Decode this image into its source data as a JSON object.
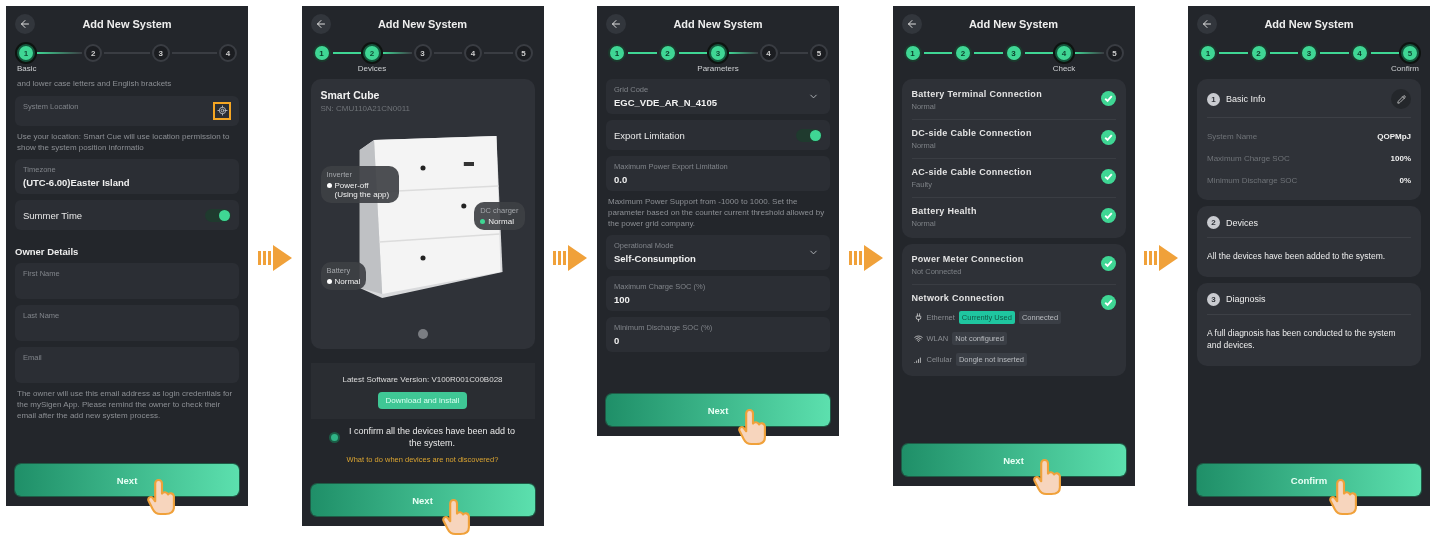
{
  "screens": [
    {
      "title": "Add New System",
      "steps": [
        {
          "label": "1",
          "done": false,
          "selected": true
        },
        {
          "label": "2",
          "done": false,
          "selected": false
        },
        {
          "label": "3",
          "done": false,
          "selected": false
        },
        {
          "label": "4",
          "done": false,
          "selected": false
        }
      ],
      "caption": "Basic",
      "sections": [
        {
          "kind": "note",
          "text": "and lower case letters and English brackets"
        },
        {
          "kind": "field",
          "label": "System Location",
          "locate": true,
          "highlighted": true
        },
        {
          "kind": "note",
          "text": "Use your location: Smart Cue will use location permission to show the system position informatio"
        },
        {
          "kind": "field",
          "label": "Timezone",
          "value": "(UTC-6.00)Easter Island"
        },
        {
          "kind": "toggle",
          "label": "Summer Time",
          "on": true
        },
        {
          "kind": "heading",
          "text": "Owner Details"
        },
        {
          "kind": "field",
          "label": "First Name"
        },
        {
          "kind": "field",
          "label": "Last Name"
        },
        {
          "kind": "field",
          "label": "Email"
        },
        {
          "kind": "note",
          "text": "The owner will use this email address as login credentials for the mySigen App. Please remind the owner to check their email after the add new system process."
        }
      ],
      "button": "Next"
    },
    {
      "title": "Add New System",
      "steps": [
        {
          "label": "1",
          "done": true,
          "selected": false
        },
        {
          "label": "2",
          "done": false,
          "selected": true
        },
        {
          "label": "3",
          "done": false,
          "selected": false
        },
        {
          "label": "4",
          "done": false,
          "selected": false
        },
        {
          "label": "5",
          "done": false,
          "selected": false
        }
      ],
      "caption": "Devices",
      "sections": [
        {
          "kind": "device",
          "name": "Smart Cube",
          "sn": "SN: CMU110A21CN0011",
          "callouts": [
            {
              "title": "Inverter",
              "status": "Power-off (Using the app)",
              "color": "#ffffff"
            },
            {
              "title": "DC charger",
              "status": "Normal",
              "color": "#3fd694"
            },
            {
              "title": "Battery",
              "status": "Normal",
              "color": "#ffffff"
            }
          ]
        },
        {
          "kind": "software",
          "text": "Latest Software Version: V100R001C00B028",
          "button": "Download and install"
        },
        {
          "kind": "confirm",
          "checked": true,
          "text": "I confirm all the devices have been add to the system.",
          "link": "What to do when devices are not discovered?"
        }
      ],
      "button": "Next"
    },
    {
      "title": "Add New System",
      "steps": [
        {
          "label": "1",
          "done": true,
          "selected": false
        },
        {
          "label": "2",
          "done": true,
          "selected": false
        },
        {
          "label": "3",
          "done": false,
          "selected": true
        },
        {
          "label": "4",
          "done": false,
          "selected": false
        },
        {
          "label": "5",
          "done": false,
          "selected": false
        }
      ],
      "caption": "Parameters",
      "sections": [
        {
          "kind": "field",
          "label": "Grid Code",
          "value": "EGC_VDE_AR_N_4105",
          "dropdown": true
        },
        {
          "kind": "toggle",
          "label": "Export Limitation",
          "on": true
        },
        {
          "kind": "field",
          "label": "Maximum Power Export Limitation",
          "value": "0.0"
        },
        {
          "kind": "note",
          "text": "Maximum Power Support from -1000 to 1000. Set the parameter based on the counter current threshold allowed by the power grid company."
        },
        {
          "kind": "field",
          "label": "Operational Mode",
          "value": "Self-Consumption",
          "dropdown": true
        },
        {
          "kind": "field",
          "label": "Maximum Charge SOC (%)",
          "value": "100"
        },
        {
          "kind": "field",
          "label": "Minimum Discharge SOC (%)",
          "value": "0"
        }
      ],
      "button": "Next"
    },
    {
      "title": "Add New System",
      "steps": [
        {
          "label": "1",
          "done": true,
          "selected": false
        },
        {
          "label": "2",
          "done": true,
          "selected": false
        },
        {
          "label": "3",
          "done": true,
          "selected": false
        },
        {
          "label": "4",
          "done": false,
          "selected": true
        },
        {
          "label": "5",
          "done": false,
          "selected": false
        }
      ],
      "caption": "Check",
      "sections": [
        {
          "kind": "checks",
          "items": [
            {
              "kind": "check",
              "title": "Battery Terminal Connection",
              "status": "Normal",
              "ok": true
            },
            {
              "kind": "check",
              "title": "DC-side Cable Connection",
              "status": "Normal",
              "ok": true
            },
            {
              "kind": "check",
              "title": "AC-side Cable Connection",
              "status": "Faulty",
              "ok": true
            },
            {
              "kind": "check",
              "title": "Battery Health",
              "status": "Normal",
              "ok": true
            }
          ]
        },
        {
          "kind": "checks",
          "items": [
            {
              "kind": "check",
              "title": "Power Meter Connection",
              "status": "Not Connected",
              "ok": true
            },
            {
              "kind": "network",
              "title": "Network Connection",
              "ok": true,
              "links": [
                {
                  "kind": "ethernet",
                  "name": "Ethernet",
                  "badges": [
                    {
                      "text": "Currently Used",
                      "highlighted": true
                    },
                    {
                      "text": "Connected",
                      "highlighted": false
                    }
                  ]
                },
                {
                  "kind": "wlan",
                  "name": "WLAN",
                  "badges": [
                    {
                      "text": "Not configured",
                      "highlighted": false
                    }
                  ]
                },
                {
                  "kind": "cellular",
                  "name": "Cellular",
                  "badges": [
                    {
                      "text": "Dongle not inserted",
                      "highlighted": false
                    }
                  ]
                }
              ]
            }
          ]
        }
      ],
      "button": "Next"
    },
    {
      "title": "Add New System",
      "steps": [
        {
          "label": "1",
          "done": true,
          "selected": false
        },
        {
          "label": "2",
          "done": true,
          "selected": false
        },
        {
          "label": "3",
          "done": true,
          "selected": false
        },
        {
          "label": "4",
          "done": true,
          "selected": false
        },
        {
          "label": "5",
          "done": false,
          "selected": true
        }
      ],
      "caption": "Confirm",
      "sections": [
        {
          "kind": "summary",
          "number": "1",
          "title": "Basic Info",
          "editable": true,
          "rows": [
            {
              "label": "System Name",
              "value": "QOPMpJ"
            },
            {
              "label": "Maximum Charge SOC",
              "value": "100%"
            },
            {
              "label": "Minimum Discharge SOC",
              "value": "0%"
            }
          ]
        },
        {
          "kind": "summary",
          "number": "2",
          "title": "Devices",
          "text": "All the devices have been added to the system."
        },
        {
          "kind": "summary",
          "number": "3",
          "title": "Diagnosis",
          "text": "A full diagnosis has been conducted to the system and devices."
        }
      ],
      "button": "Confirm"
    }
  ]
}
